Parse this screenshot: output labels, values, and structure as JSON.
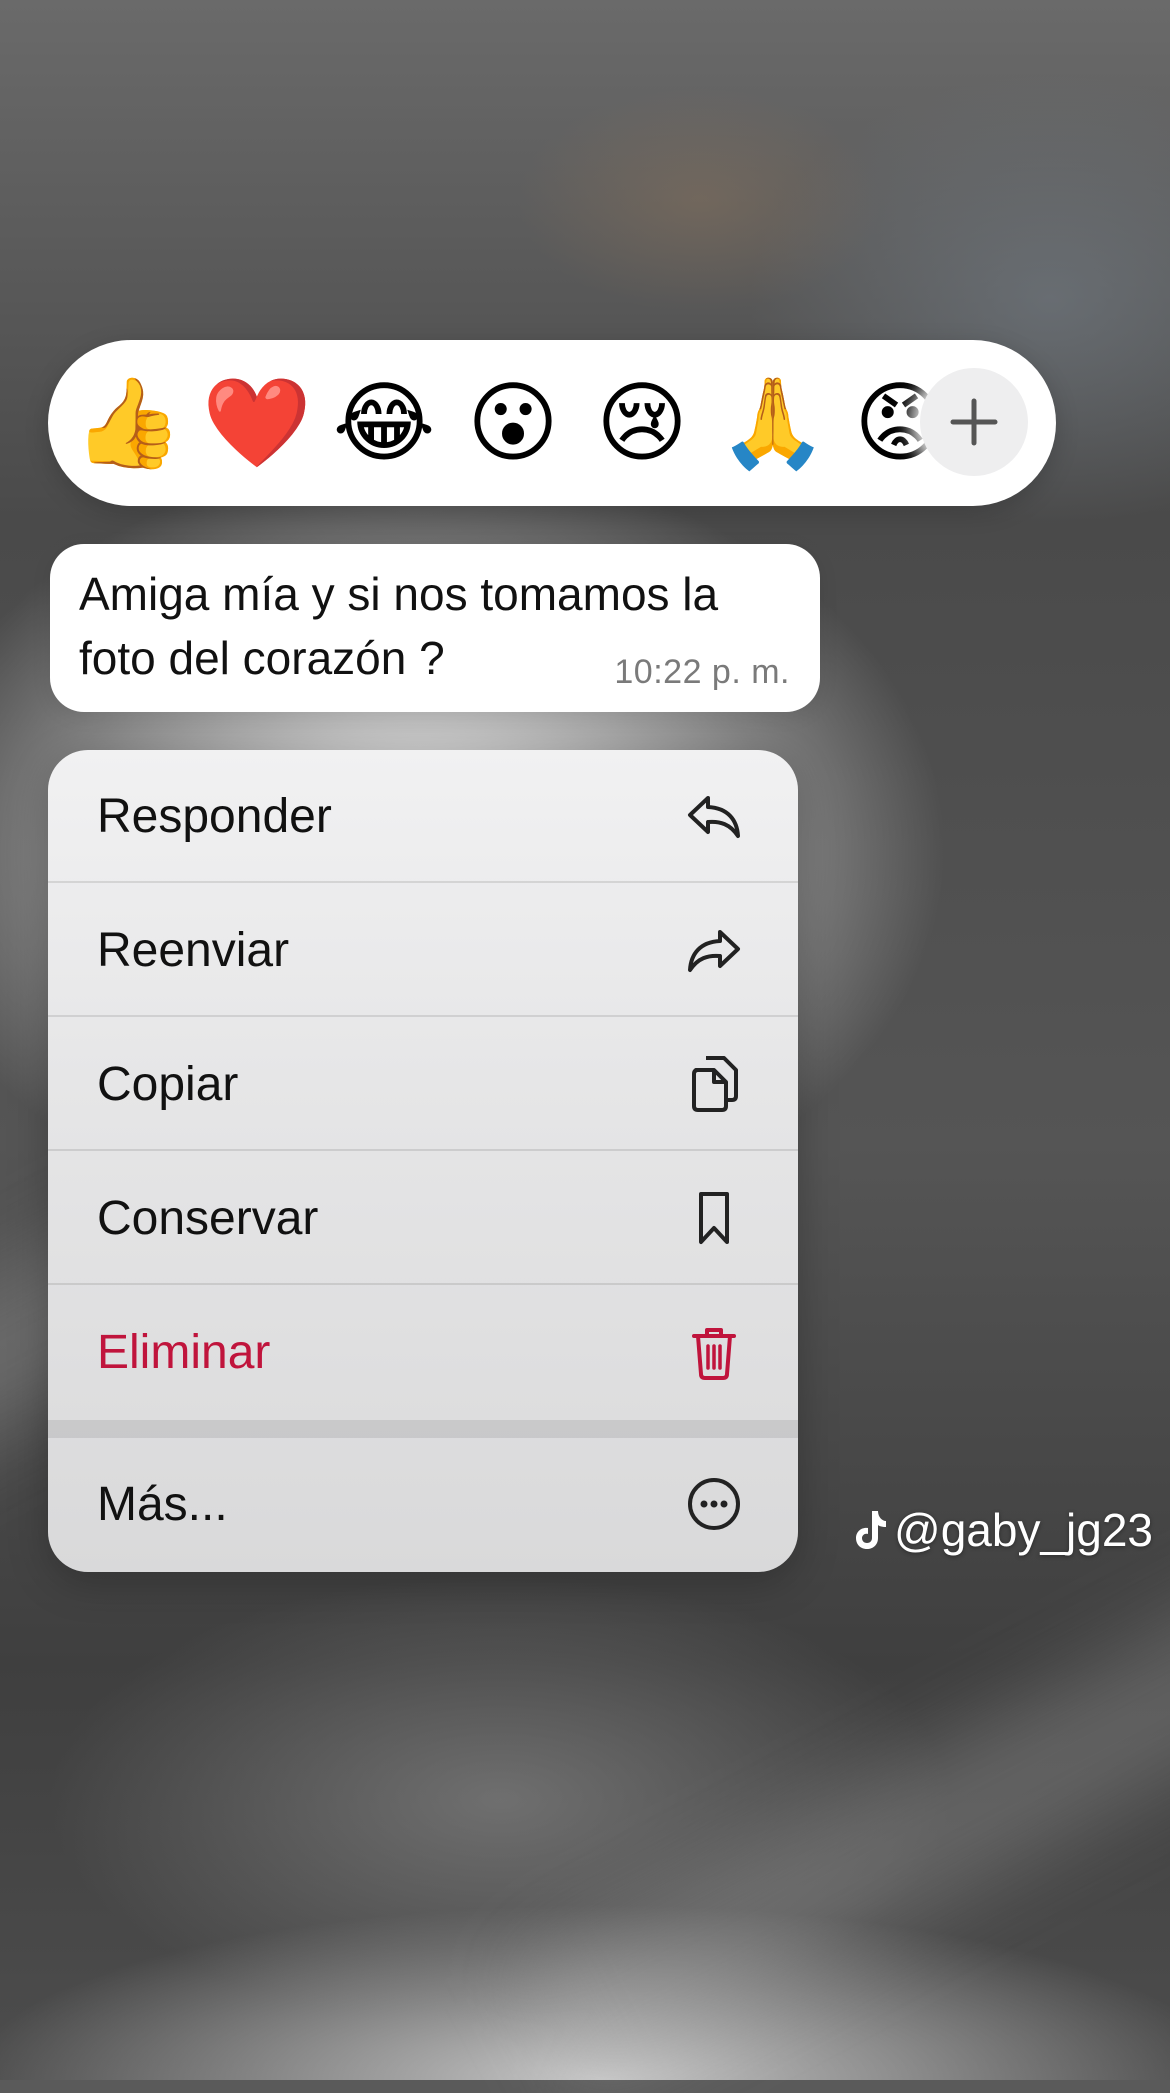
{
  "reactions": {
    "emojis": [
      {
        "char": "👍",
        "name": "thumbs-up"
      },
      {
        "char": "❤️",
        "name": "red-heart"
      },
      {
        "char": "😂",
        "name": "tears-of-joy"
      },
      {
        "char": "😮",
        "name": "open-mouth"
      },
      {
        "char": "😢",
        "name": "crying-face"
      },
      {
        "char": "🙏",
        "name": "folded-hands"
      },
      {
        "char": "😡",
        "name": "angry-face"
      }
    ],
    "more_icon": "plus-icon"
  },
  "message": {
    "text": "Amiga mía y si nos tomamos la foto del corazón ?",
    "time": "10:22 p. m."
  },
  "menu": {
    "items": [
      {
        "label": "Responder",
        "icon": "reply-icon"
      },
      {
        "label": "Reenviar",
        "icon": "forward-icon"
      },
      {
        "label": "Copiar",
        "icon": "copy-icon"
      },
      {
        "label": "Conservar",
        "icon": "bookmark-icon"
      },
      {
        "label": "Eliminar",
        "icon": "trash-icon",
        "color": "#c0143c"
      },
      {
        "label": "Más...",
        "icon": "more-icon"
      }
    ]
  },
  "watermark": {
    "text": "@gaby_jg23",
    "icon": "tiktok-icon"
  }
}
